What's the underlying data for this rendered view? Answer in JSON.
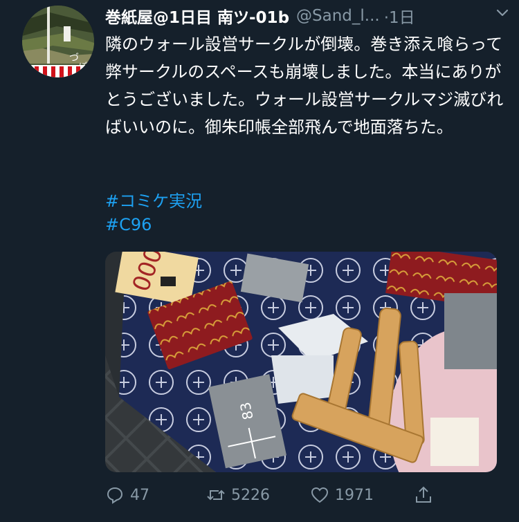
{
  "tweet": {
    "display_name": "巻紙屋@1日目 南ツ-01b",
    "handle": "@Sand_l...",
    "time": "·1日",
    "text": "隣のウォール設営サークルが倒壊。巻き添え喰らって弊サークルのスペースも崩壊しました。本当にありがとうございました。ウォール設営サークルマジ滅びればいいのに。御朱印帳全部飛んで地面落ちた。",
    "hashtags": [
      "#コミケ実況",
      "#C96"
    ],
    "photo_text": {
      "price_label": "000",
      "box_number": "83"
    },
    "actions": {
      "reply_count": "47",
      "retweet_count": "5226",
      "like_count": "1971"
    }
  },
  "colors": {
    "background": "#15202b",
    "link": "#1da1f2",
    "muted": "#8899a6"
  },
  "icons": {
    "more": "chevron-down-icon",
    "reply": "reply-icon",
    "retweet": "retweet-icon",
    "like": "heart-icon",
    "share": "share-icon"
  }
}
